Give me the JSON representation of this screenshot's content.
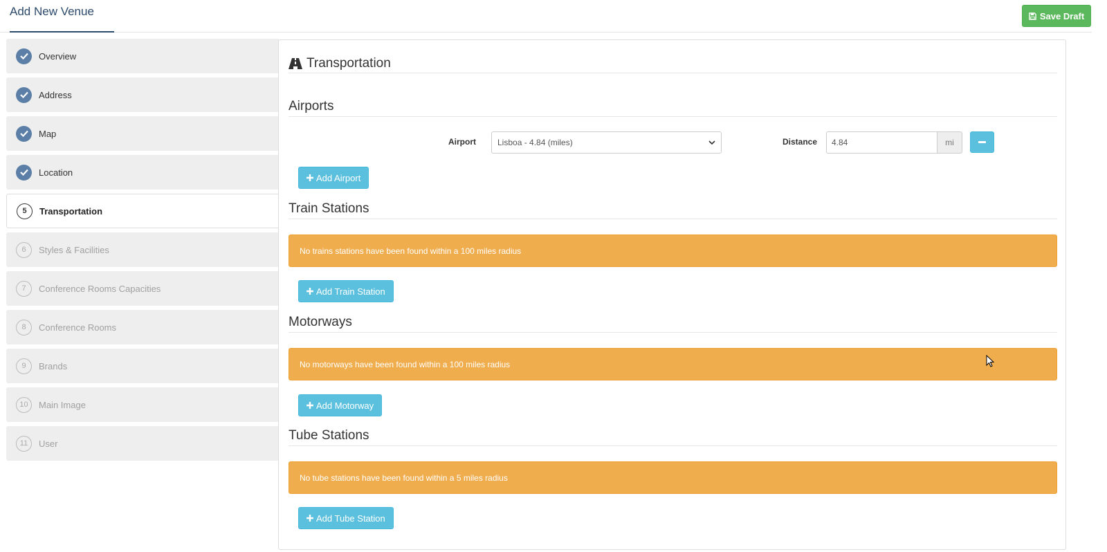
{
  "header": {
    "title": "Add New Venue",
    "save_label": "Save Draft"
  },
  "steps": [
    {
      "num": "",
      "label": "Overview",
      "state": "done"
    },
    {
      "num": "",
      "label": "Address",
      "state": "done"
    },
    {
      "num": "",
      "label": "Map",
      "state": "done"
    },
    {
      "num": "",
      "label": "Location",
      "state": "done"
    },
    {
      "num": "5",
      "label": "Transportation",
      "state": "active"
    },
    {
      "num": "6",
      "label": "Styles & Facilities",
      "state": "todo"
    },
    {
      "num": "7",
      "label": "Conference Rooms Capacities",
      "state": "todo"
    },
    {
      "num": "8",
      "label": "Conference Rooms",
      "state": "todo"
    },
    {
      "num": "9",
      "label": "Brands",
      "state": "todo"
    },
    {
      "num": "10",
      "label": "Main Image",
      "state": "todo"
    },
    {
      "num": "11",
      "label": "User",
      "state": "todo"
    }
  ],
  "main": {
    "title": "Transportation",
    "title_icon": "road-icon",
    "airports": {
      "heading": "Airports",
      "airport_label": "Airport",
      "airport_value": "Lisboa - 4.84 (miles)",
      "distance_label": "Distance",
      "distance_value": "4.84",
      "distance_unit": "mi",
      "add_label": "Add Airport"
    },
    "train": {
      "heading": "Train Stations",
      "alert": "No trains stations have been found within a 100 miles radius",
      "add_label": "Add Train Station"
    },
    "motorways": {
      "heading": "Motorways",
      "alert": "No motorways have been found within a 100 miles radius",
      "add_label": "Add Motorway"
    },
    "tube": {
      "heading": "Tube Stations",
      "alert": "No tube stations have been found within a 5 miles radius",
      "add_label": "Add Tube Station"
    }
  },
  "colors": {
    "success": "#5cb85c",
    "info": "#5bc0de",
    "warning": "#f0ad4e",
    "step_done": "#5b7fa6",
    "title": "#2c4a6b"
  }
}
